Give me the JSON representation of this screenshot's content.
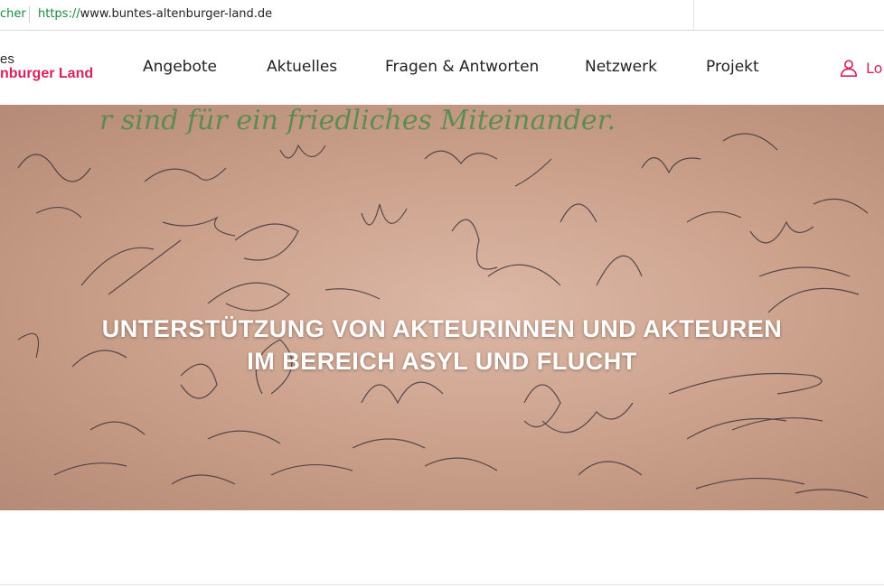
{
  "browser": {
    "secure_label": "cher",
    "url_scheme": "https://",
    "url_host": "www.buntes-altenburger-land.de"
  },
  "site": {
    "logo_line1": "es",
    "logo_line2": "nburger Land",
    "nav": [
      "Angebote",
      "Aktuelles",
      "Fragen & Antworten",
      "Netzwerk",
      "Projekt"
    ],
    "login_label": "Lo",
    "accent_color": "#d6245a"
  },
  "hero": {
    "top_text": "r sind für ein friedliches Miteinander.",
    "title_line1": "UNTERSTÜTZUNG VON AKTEURINNEN UND AKTEUREN",
    "title_line2": "IM BEREICH ASYL UND FLUCHT"
  }
}
